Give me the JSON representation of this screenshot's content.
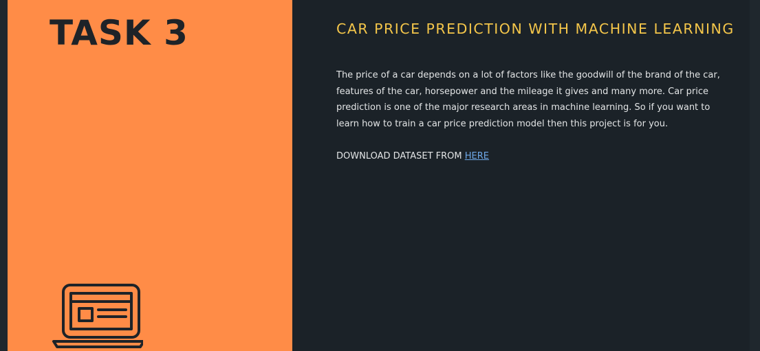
{
  "task": {
    "title": "TASK 3",
    "icon": "laptop-icon"
  },
  "content": {
    "headline": "CAR PRICE PREDICTION WITH MACHINE LEARNING",
    "description": "The price of a car depends on a lot of factors like the goodwill of the brand of the car, features of the car, horsepower and the mileage it gives and many more. Car price prediction is one of the major research areas in machine learning. So if you want to learn how to train a car price prediction model then this project is for you.",
    "download_prefix": "DOWNLOAD DATASET FROM ",
    "download_link_text": "HERE"
  },
  "colors": {
    "accent_orange": "#ff8c47",
    "dark_background": "#1b2228",
    "headline_yellow": "#f4c64a",
    "link_blue": "#6ea8e8"
  }
}
